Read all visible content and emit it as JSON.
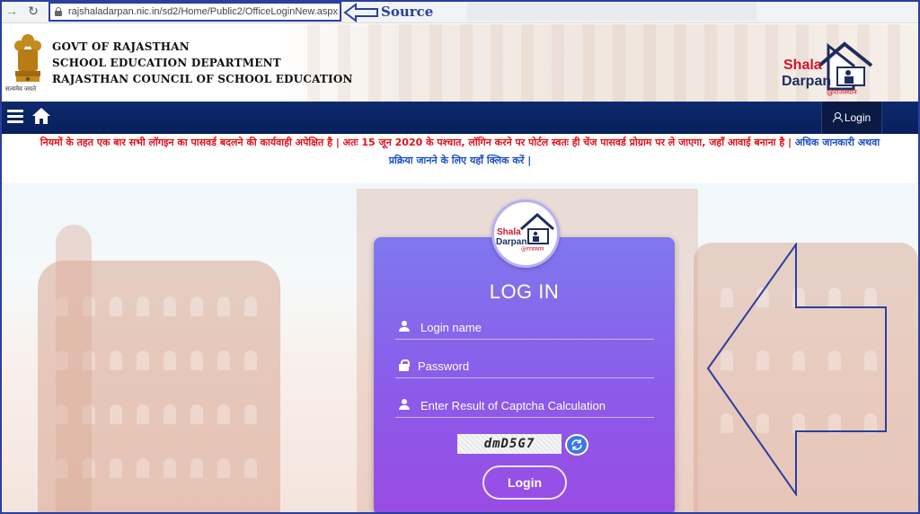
{
  "browser": {
    "url": "rajshaladarpan.nic.in/sd2/Home/Public2/OfficeLoginNew.aspx",
    "annotation": "Source"
  },
  "header": {
    "emblem_caption": "सत्यमेव जयते",
    "line1": "GOVT OF RAJASTHAN",
    "line2": "SCHOOL EDUCATION DEPARTMENT",
    "line3": "RAJASTHAN COUNCIL OF SCHOOL EDUCATION",
    "logo_word1": "Shala",
    "logo_word2": "Darpan",
    "logo_tag": "@राजस्थान"
  },
  "navbar": {
    "login_label": "Login"
  },
  "notice": {
    "red_text": "नियमों के तहत एक बार सभी लॉगइन का पासवर्ड बदलने की कार्यवाही अपेक्षित है | अतः 15 जून 2020 के पश्चात, लॉगिन करने पर पोर्टल स्वतः ही चेंज पासवर्ड प्रोग्राम पर ले जाएगा, जहाँ आवाई बनाना है |",
    "blue_text_a": "अधिक जानकारी अथवा",
    "blue_text_b": "प्रक्रिया जानने के लिए यहाँ क्लिक करें |"
  },
  "login_card": {
    "title": "LOG IN",
    "username_placeholder": "Login name",
    "password_placeholder": "Password",
    "captcha_placeholder": "Enter Result of Captcha Calculation",
    "captcha_text": "dmD5G7",
    "submit_label": "Login",
    "logo_word1": "Shala",
    "logo_word2": "Darpan",
    "logo_tag": "@राजस्थान"
  },
  "colors": {
    "navbar": "#07205c",
    "card_top": "#7f78ee",
    "card_bottom": "#9a4be4",
    "notice_red": "#e3101a",
    "notice_blue": "#1a4fc4",
    "annotation_blue": "#2b3fa0"
  },
  "icons": [
    "back-arrow-icon",
    "reload-icon",
    "lock-icon",
    "hamburger-icon",
    "home-icon",
    "user-icon",
    "refresh-icon"
  ]
}
